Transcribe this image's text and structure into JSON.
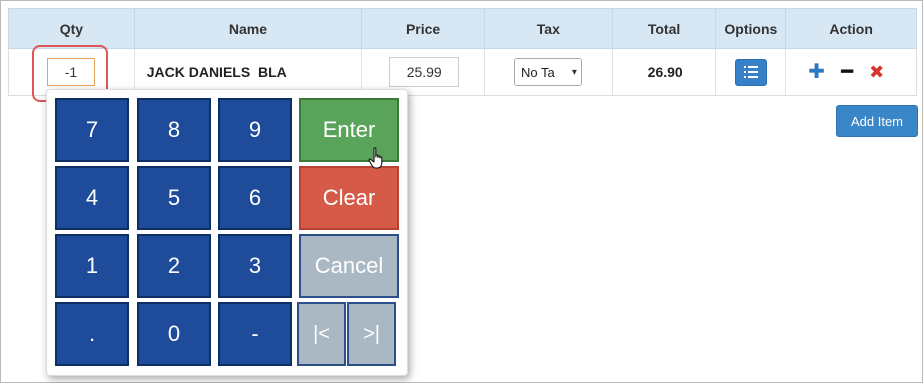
{
  "table": {
    "headers": [
      "Qty",
      "Name",
      "Price",
      "Tax",
      "Total",
      "Options",
      "Action"
    ],
    "row": {
      "qty": "-1",
      "name": "JACK DANIELS  BLA",
      "price": "25.99",
      "tax": "No Ta",
      "total": "26.90"
    }
  },
  "buttons": {
    "add_item": "Add Item"
  },
  "keypad": {
    "k7": "7",
    "k8": "8",
    "k9": "9",
    "k4": "4",
    "k5": "5",
    "k6": "6",
    "k1": "1",
    "k2": "2",
    "k3": "3",
    "kdot": ".",
    "k0": "0",
    "kminus": "-",
    "enter": "Enter",
    "clear": "Clear",
    "cancel": "Cancel",
    "prev": "|<",
    "next": ">|"
  },
  "icons": {
    "options": "list-icon",
    "add": "plus-icon",
    "remove": "minus-icon",
    "delete": "close-icon",
    "dropdown": "chevron-down-icon",
    "pointer": "hand-pointer-icon"
  },
  "colors": {
    "header_bg": "#d7e7f4",
    "keypad_blue": "#1e4c9a",
    "enter_green": "#5aa35a",
    "clear_red": "#d55a47",
    "cancel_gray": "#aab8c4",
    "add_item_blue": "#3a87c8",
    "highlight_red": "#e05555"
  }
}
